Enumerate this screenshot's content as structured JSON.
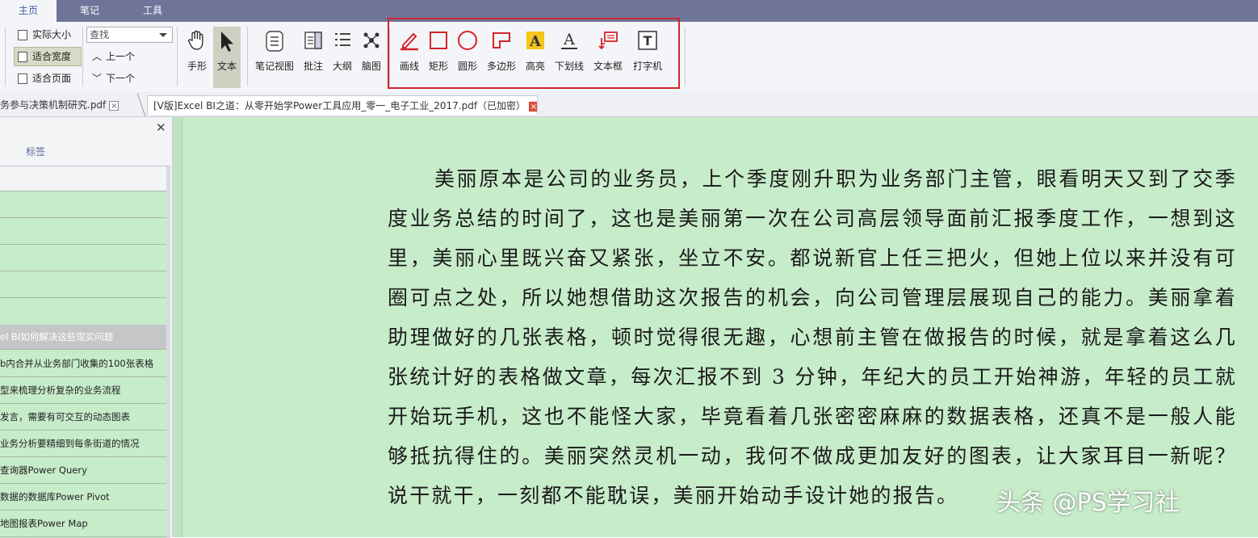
{
  "menu": {
    "tabs": [
      "主页",
      "笔记",
      "工具"
    ]
  },
  "ribbon": {
    "view": {
      "actual_size": "实际大小",
      "fit_width": "适合宽度",
      "fit_page": "适合页面"
    },
    "search": {
      "placeholder": "查找",
      "prev": "上一个",
      "next": "下一个"
    },
    "tools": {
      "hand": "手形",
      "text": "文本"
    },
    "views": {
      "note_view": "笔记视图",
      "annotate": "批注",
      "outline": "大纲",
      "mindmap": "脑图"
    },
    "markup": {
      "pen": "画线",
      "rect": "矩形",
      "circle": "圆形",
      "polygon": "多边形",
      "highlight": "高亮",
      "underline": "下划线",
      "textbox": "文本框",
      "typewriter": "打字机"
    },
    "colors": {
      "markup_red": "#d2252c",
      "highlight_yellow": "#f5c518"
    }
  },
  "tabs": [
    {
      "title": "务参与决策机制研究.pdf"
    },
    {
      "title": "[V版]Excel BI之道：从零开始学Power工具应用_零一_电子工业_2017.pdf（已加密）"
    }
  ],
  "sidebar": {
    "tab_label": "标签",
    "items": [
      "",
      "",
      "",
      "",
      "",
      "el BI如何解决这些现实问题",
      "b内合并从业务部门收集的100张表格",
      "型来梳理分析复杂的业务流程",
      "发言，需要有可交互的动态图表",
      "业务分析要精细到每条街道的情况",
      "查询器Power Query",
      "数据的数据库Power Pivot",
      "地图报表Power Map"
    ]
  },
  "document": {
    "paragraph": "美丽原本是公司的业务员，上个季度刚升职为业务部门主管，眼看明天又到了交季度业务总结的时间了，这也是美丽第一次在公司高层领导面前汇报季度工作，一想到这里，美丽心里既兴奋又紧张，坐立不安。都说新官上任三把火，但她上位以来并没有可圈可点之处，所以她想借助这次报告的机会，向公司管理层展现自己的能力。美丽拿着助理做好的几张表格，顿时觉得很无趣，心想前主管在做报告的时候，就是拿着这么几张统计好的表格做文章，每次汇报不到 3 分钟，年纪大的员工开始神游，年轻的员工就开始玩手机，这也不能怪大家，毕竟看着几张密密麻麻的数据表格，还真不是一般人能够抵抗得住的。美丽突然灵机一动，我何不做成更加友好的图表，让大家耳目一新呢？说干就干，一刻都不能耽误，美丽开始动手设计她的报告。",
    "watermark": "头条 @PS学习社"
  }
}
